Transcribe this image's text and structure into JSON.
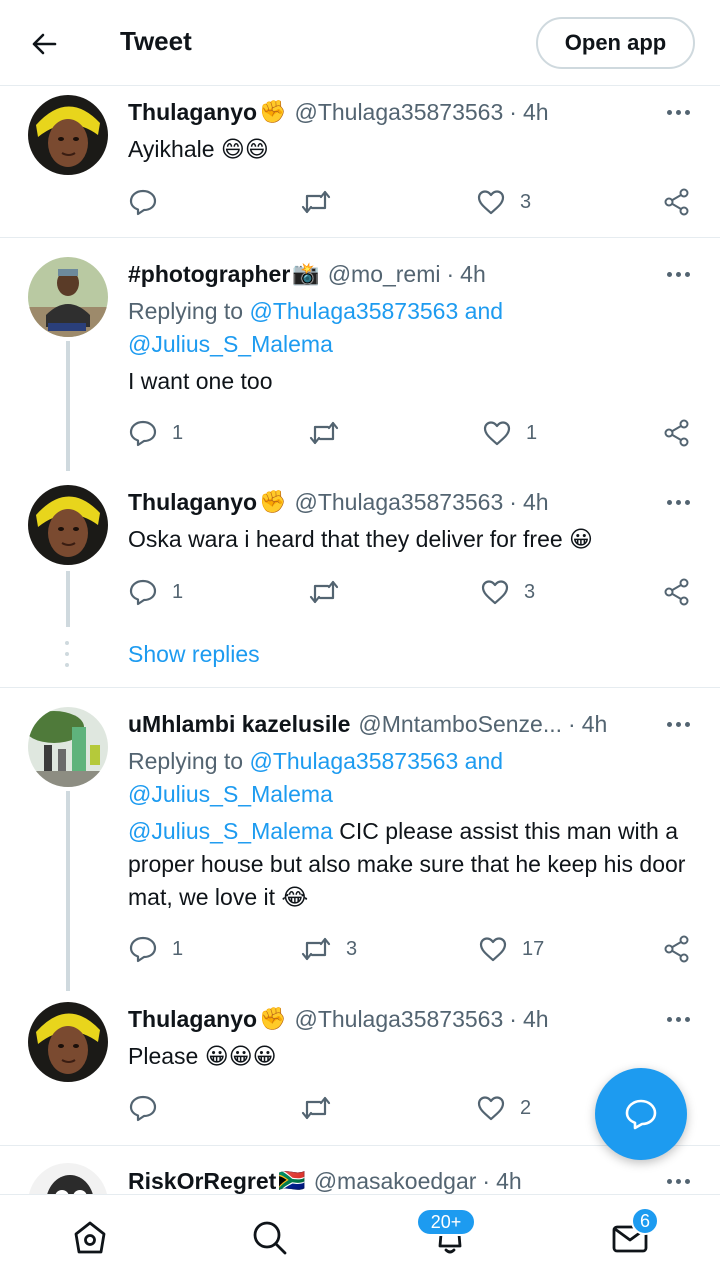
{
  "header": {
    "title": "Tweet",
    "open_app_label": "Open app"
  },
  "tweets": [
    {
      "name": "Thulaganyo",
      "badge": "✊",
      "handle": "@Thulaga35873563",
      "sep": "·",
      "time": "4h",
      "text": "Ayikhale 😄😄",
      "replies": "",
      "retweets": "",
      "likes": "3"
    },
    {
      "name": "#photographer",
      "badge": "📸",
      "handle": "@mo_remi",
      "sep": "·",
      "time": "4h",
      "replying_prefix": "Replying to",
      "replying_link1": "@Thulaga35873563 and",
      "replying_link2": "@Julius_S_Malema",
      "text": "I want one too",
      "replies": "1",
      "retweets": "",
      "likes": "1"
    },
    {
      "name": "Thulaganyo",
      "badge": "✊",
      "handle": "@Thulaga35873563",
      "sep": "·",
      "time": "4h",
      "text": "Oska wara i heard that they deliver for free 😀",
      "replies": "1",
      "retweets": "",
      "likes": "3"
    },
    {
      "name": "uMhlambi kazelusile",
      "handle": "@MntamboSenze...",
      "sep": "·",
      "time": "4h",
      "replying_prefix": "Replying to",
      "replying_link1": "@Thulaga35873563 and",
      "replying_link2": "@Julius_S_Malema",
      "mention": "@Julius_S_Malema",
      "text": " CIC please assist this man with a proper house but also make sure that he keep his door mat, we love it 😂",
      "replies": "1",
      "retweets": "3",
      "likes": "17"
    },
    {
      "name": "Thulaganyo",
      "badge": "✊",
      "handle": "@Thulaga35873563",
      "sep": "·",
      "time": "4h",
      "text": "Please 😀😀😀",
      "replies": "",
      "retweets": "",
      "likes": "2"
    },
    {
      "name": "RiskOrRegret",
      "badge": "🇿🇦",
      "handle": "@masakoedgar",
      "sep": "·",
      "time": "4h"
    }
  ],
  "show_replies_label": "Show replies",
  "nav": {
    "notifications_badge": "20+",
    "messages_badge": "6"
  },
  "icons": [
    "back-arrow-icon",
    "reply-icon",
    "retweet-icon",
    "like-icon",
    "share-icon",
    "more-icon",
    "compose-icon",
    "home-icon",
    "search-icon",
    "notifications-icon",
    "messages-icon"
  ],
  "colors": {
    "accent": "#1d9bf0",
    "secondary_text": "#536471",
    "divider": "#e6ecf0"
  }
}
